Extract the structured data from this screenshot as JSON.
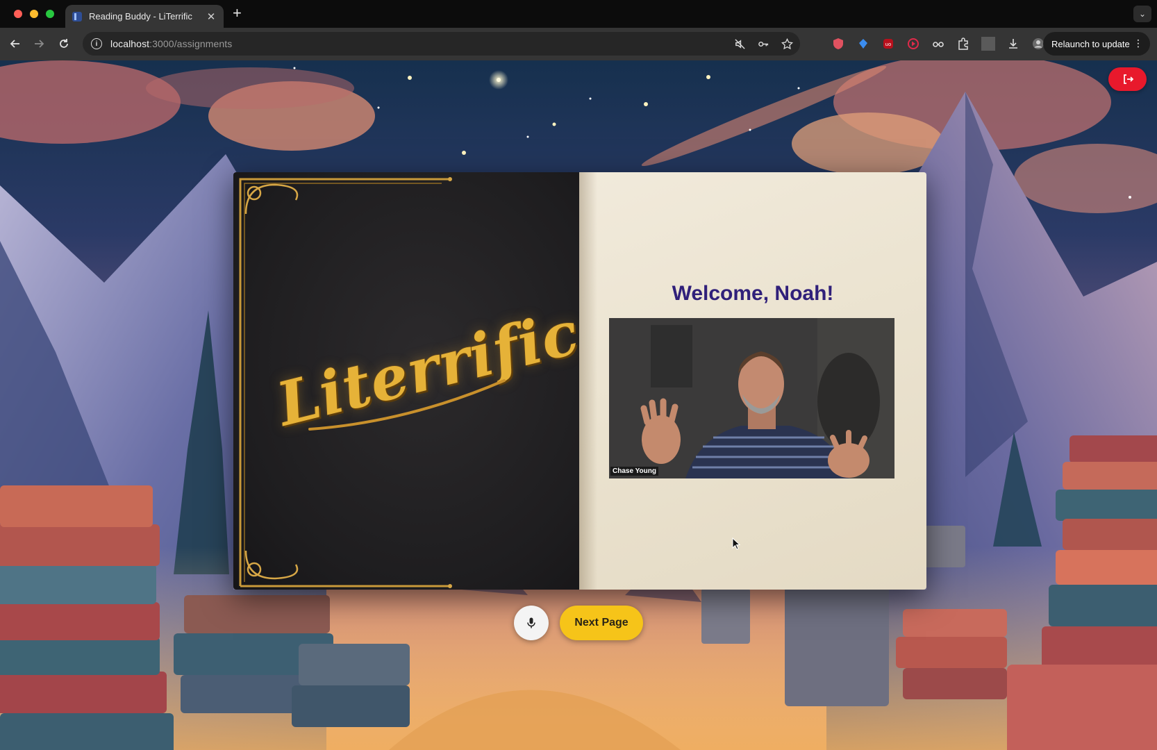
{
  "browser": {
    "tab_title": "Reading Buddy - LiTerrific",
    "url_host": "localhost",
    "url_path": ":3000/assignments",
    "relaunch_label": "Relaunch to update"
  },
  "page": {
    "logo_text": "Literrific",
    "welcome_text": "Welcome, Noah!",
    "video_participant_name": "Chase Young",
    "next_button_label": "Next Page"
  },
  "colors": {
    "logout_button": "#e8192c",
    "next_button": "#f6c419",
    "welcome_text": "#30207a",
    "logo_gold": "#e6b238"
  },
  "icons": {
    "logout": "logout-icon",
    "mic": "microphone-icon"
  }
}
